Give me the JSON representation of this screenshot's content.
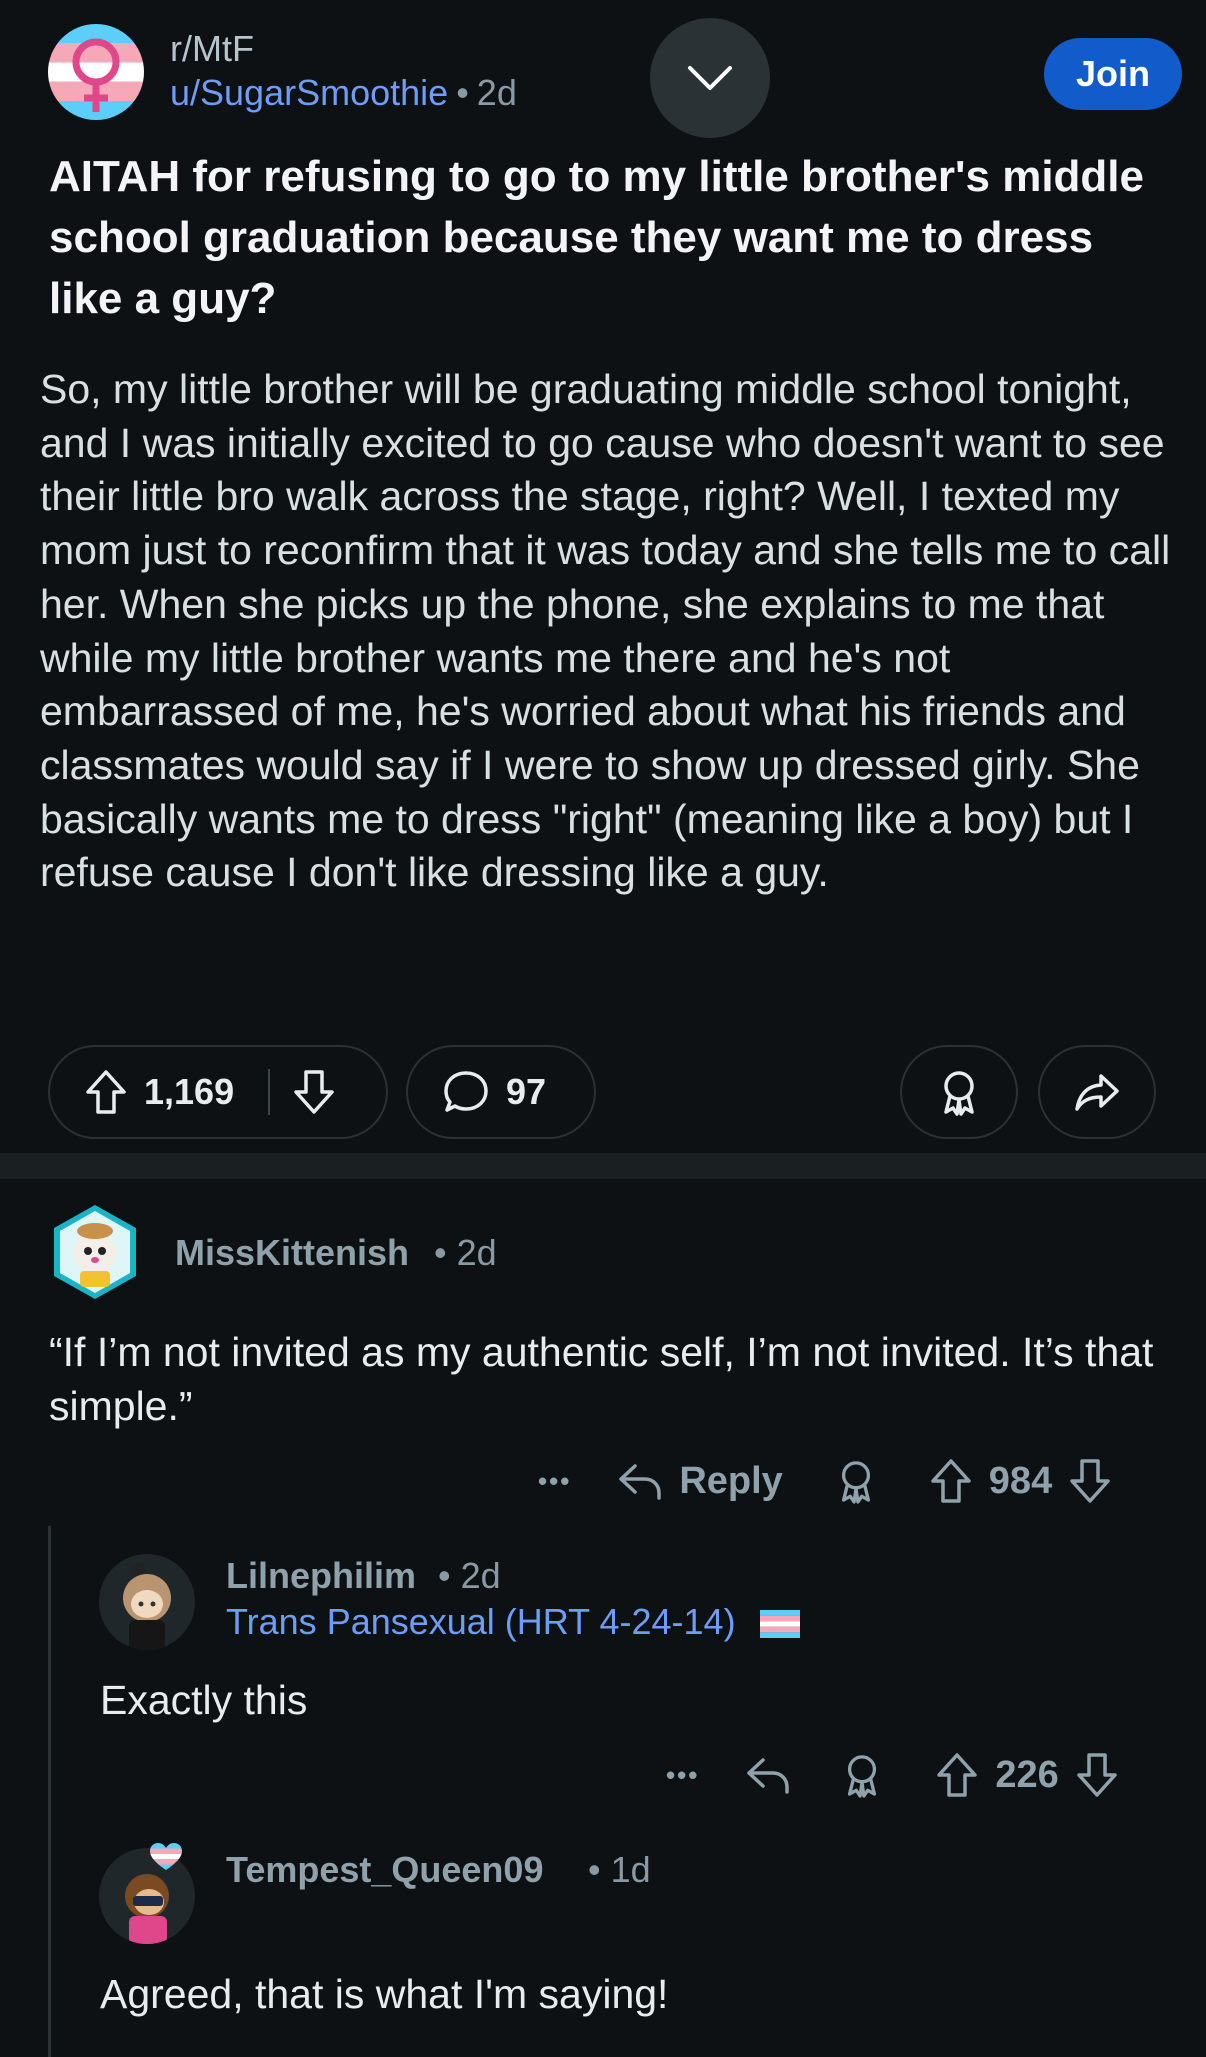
{
  "post": {
    "subreddit": "r/MtF",
    "author": "u/SugarSmoothie",
    "separator": "•",
    "age": "2d",
    "join_label": "Join",
    "title": "AITAH for refusing to go to my little brother's middle school graduation because they want me to dress like a guy?",
    "body": "So, my little brother will be graduating middle school tonight, and I was initially excited to go cause who doesn't want to see their little bro walk across the stage, right? Well, I texted my mom just to reconfirm that it was today and she tells me to call her. When she picks up the phone, she explains to me that while my little brother wants me there and he's not embarrassed of me, he's worried about what his friends and classmates would say if I were to show up dressed girly. She basically wants me to dress \"right\" (meaning like a boy) but I refuse cause I don't like dressing like a guy.",
    "upvotes": "1,169",
    "comments": "97"
  },
  "comments": [
    {
      "username": "MissKittenish",
      "age": "2d",
      "text": "“If I’m not invited as my authentic self, I’m not invited. It’s that simple.”",
      "more": "•••",
      "reply_label": "Reply",
      "score": "984"
    },
    {
      "username": "Lilnephilim",
      "age": "2d",
      "flair": "Trans Pansexual (HRT 4-24-14)",
      "text": "Exactly this",
      "more": "•••",
      "score": "226"
    },
    {
      "username": "Tempest_Queen09",
      "age": "1d",
      "text": "Agreed, that is what I'm saying!"
    }
  ],
  "colors": {
    "background": "#0e1113",
    "join_button": "#115bca",
    "username_link": "#6e9df7",
    "muted": "#8fa1ab"
  },
  "icons": [
    "chevron-down-icon",
    "upvote-icon",
    "downvote-icon",
    "comment-icon",
    "award-icon",
    "share-icon",
    "more-icon",
    "reply-icon",
    "trans-flag-icon"
  ]
}
